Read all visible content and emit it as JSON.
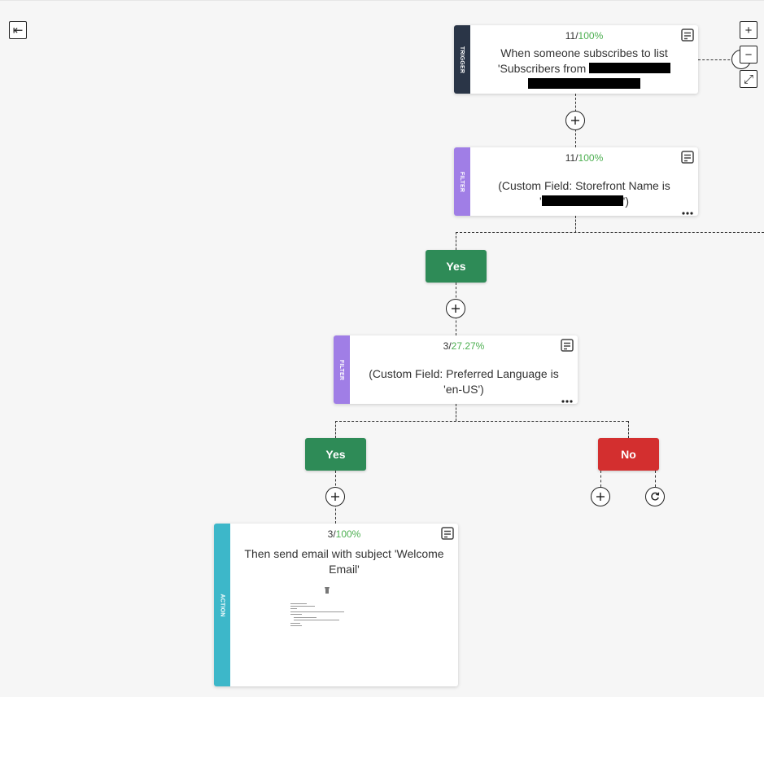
{
  "colors": {
    "trigger": "#2a3547",
    "filter": "#a07ee6",
    "action": "#3db7c9",
    "yes": "#2e8b57",
    "no": "#d32f2f",
    "percent": "#4caf50"
  },
  "controls": {
    "collapse_icon": "⇤",
    "zoom_in_icon": "+",
    "zoom_out_icon": "−",
    "fit_icon": "⤢"
  },
  "trigger": {
    "stripe_label": "TRIGGER",
    "count": "11/",
    "percent": "100%",
    "text_line1": "When someone subscribes to list",
    "text_line2": "'Subscribers from"
  },
  "filter1": {
    "stripe_label": "FILTER",
    "count": "11/",
    "percent": "100%",
    "text_line1": "(Custom Field: Storefront Name is",
    "text_line2_prefix": "'",
    "text_line2_suffix": "')"
  },
  "branch1_yes": {
    "label": "Yes"
  },
  "filter2": {
    "stripe_label": "FILTER",
    "count": "3/",
    "percent": "27.27%",
    "text": "(Custom Field: Preferred Language is 'en-US')"
  },
  "branch2_yes": {
    "label": "Yes"
  },
  "branch2_no": {
    "label": "No"
  },
  "action": {
    "stripe_label": "ACTION",
    "count": "3/",
    "percent": "100%",
    "text": "Then send email with subject 'Welcome Email'"
  }
}
